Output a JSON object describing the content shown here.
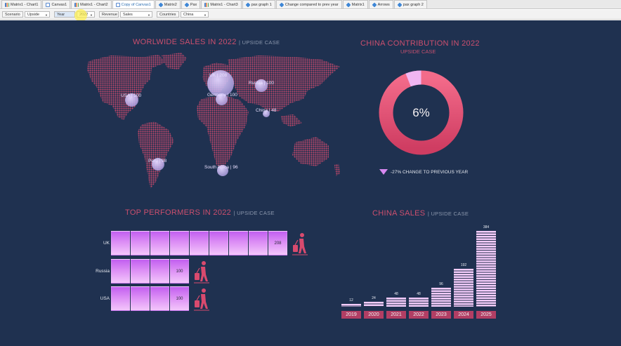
{
  "tabs": [
    {
      "label": "Matrix1 - Chart1",
      "icon": "chart-icon"
    },
    {
      "label": "Canvas1",
      "icon": "canvas-icon"
    },
    {
      "label": "Matrix1 - Chart2",
      "icon": "chart-icon"
    },
    {
      "label": "Copy of Canvas1",
      "icon": "canvas-icon",
      "active": true
    },
    {
      "label": "Matrix2",
      "icon": "cube-icon"
    },
    {
      "label": "Pax",
      "icon": "cube-icon"
    },
    {
      "label": "Matrix1 - Chart3",
      "icon": "chart-icon"
    },
    {
      "label": "pax graph 1",
      "icon": "cube-icon"
    },
    {
      "label": "Change compared to prev year",
      "icon": "cube-icon"
    },
    {
      "label": "Matrix1",
      "icon": "cube-icon"
    },
    {
      "label": "Arrows",
      "icon": "cube-icon"
    },
    {
      "label": "pax graph 2",
      "icon": "cube-icon"
    }
  ],
  "filters": {
    "scenario_label": "Scenario",
    "scenario_value": "Upside",
    "year_label": "Year",
    "year_value": "2022",
    "revenue_label": "Revenue",
    "revenue_value": "Sales",
    "countries_label": "Countries",
    "countries_value": "China"
  },
  "world": {
    "title": "WORLWIDE SALES IN 2022",
    "subtitle": "| UPSIDE CASE",
    "bubbles": [
      {
        "label": "UK | 208",
        "value": 208
      },
      {
        "label": "USA | 100",
        "value": 100
      },
      {
        "label": "Russia | 100",
        "value": 100
      },
      {
        "label": "Germany | 100",
        "value": 100
      },
      {
        "label": "China | 48",
        "value": 48
      },
      {
        "label": "Peru | 98",
        "value": 98
      },
      {
        "label": "South Africa | 96",
        "value": 96
      }
    ]
  },
  "china_contribution": {
    "title": "CHINA CONTRIBUTION IN 2022",
    "subtitle": "UPSIDE CASE",
    "percent_label": "6%",
    "percent": 6,
    "change_label": "-27%  CHANGE TO PREVIOUS YEAR",
    "colors": {
      "ring": "#e4506f",
      "slice": "#f0b6f2"
    }
  },
  "top_performers": {
    "title": "TOP PERFORMERS IN 2022",
    "subtitle": "| UPSIDE CASE",
    "rows": [
      {
        "name": "UK",
        "value": 208,
        "value_label": "208"
      },
      {
        "name": "Russia",
        "value": 100,
        "value_label": "100"
      },
      {
        "name": "USA",
        "value": 100,
        "value_label": "100"
      }
    ]
  },
  "china_sales": {
    "title": "CHINA SALES",
    "subtitle": "| UPSIDE CASE",
    "bars": [
      {
        "year": "2019",
        "value": 12,
        "value_label": "12"
      },
      {
        "year": "2020",
        "value": 24,
        "value_label": "24"
      },
      {
        "year": "2021",
        "value": 48,
        "value_label": "48"
      },
      {
        "year": "2022",
        "value": 48,
        "value_label": "48"
      },
      {
        "year": "2023",
        "value": 96,
        "value_label": "96"
      },
      {
        "year": "2024",
        "value": 192,
        "value_label": "192"
      },
      {
        "year": "2025",
        "value": 384,
        "value_label": "384"
      }
    ]
  }
}
